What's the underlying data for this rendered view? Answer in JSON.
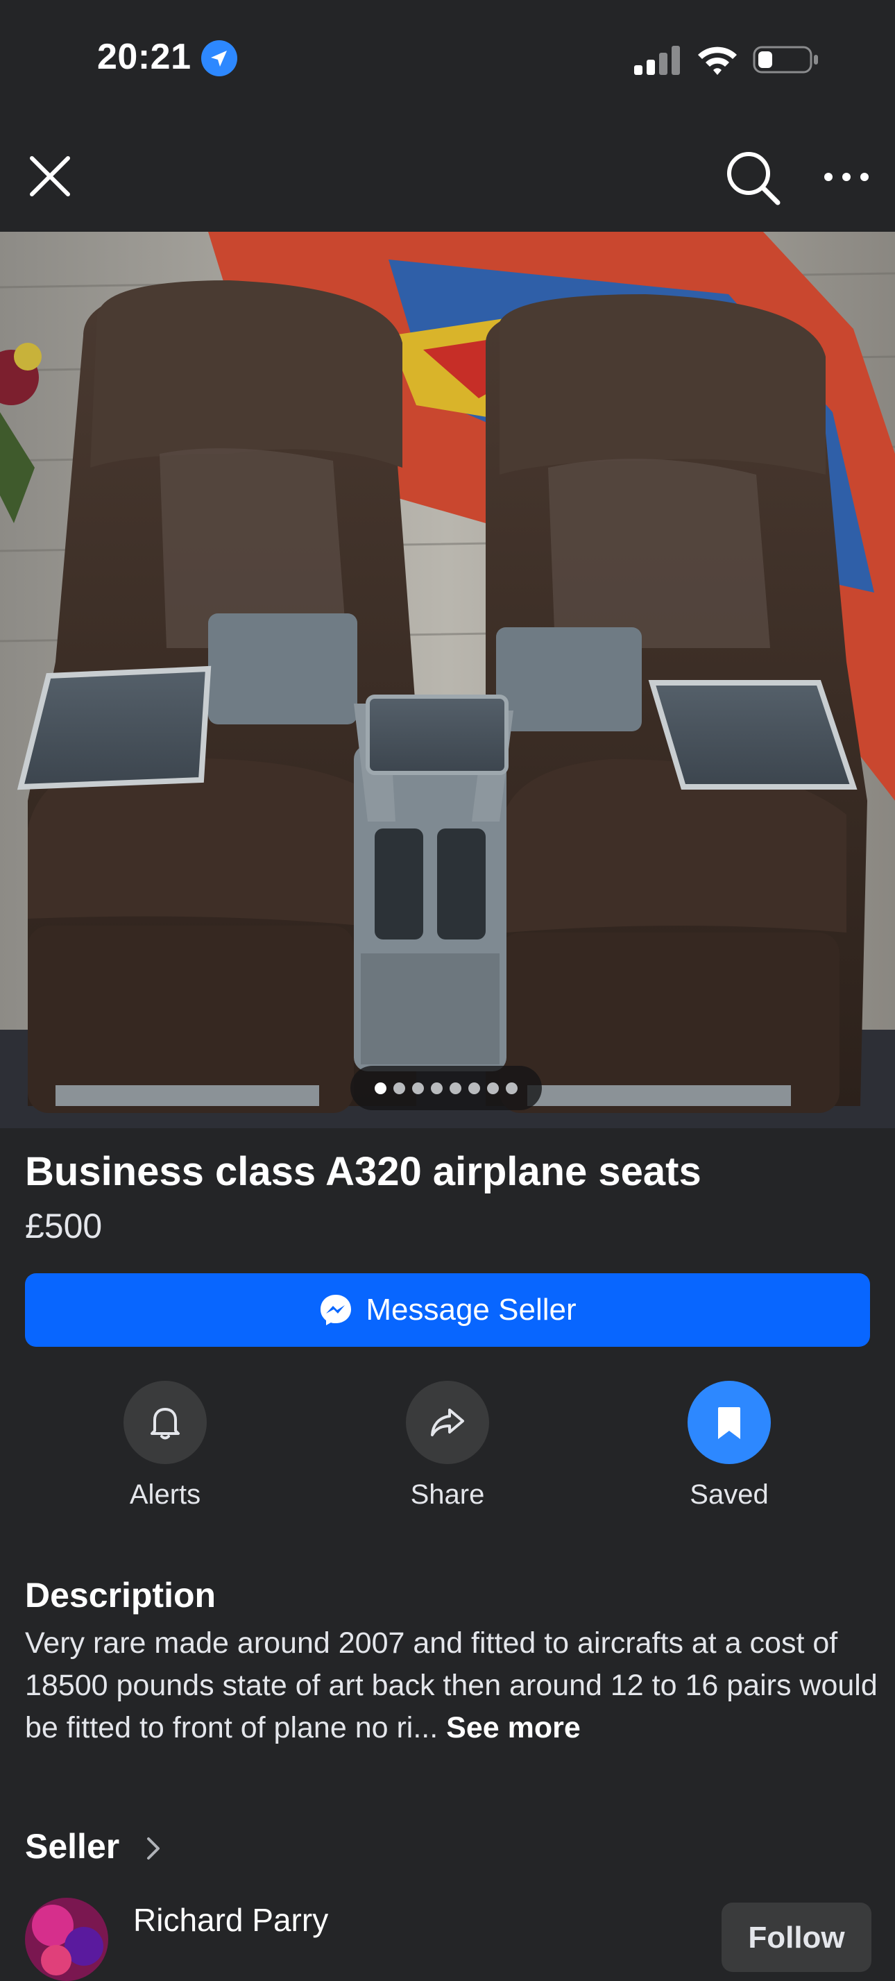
{
  "status_bar": {
    "time": "20:21",
    "icons": [
      "location-arrow-icon",
      "cellular-signal-icon",
      "wifi-icon",
      "battery-icon"
    ]
  },
  "nav": {
    "icons": [
      "close-icon",
      "search-icon",
      "more-icon"
    ]
  },
  "photo": {
    "page_count": 8,
    "current_page": 1
  },
  "listing": {
    "title": "Business  class  A320 airplane  seats",
    "price": "£500"
  },
  "message_button": {
    "label": "Message Seller",
    "icon": "messenger-icon"
  },
  "actions": [
    {
      "label": "Alerts",
      "icon": "bell-icon",
      "active": false
    },
    {
      "label": "Share",
      "icon": "share-icon",
      "active": false
    },
    {
      "label": "Saved",
      "icon": "bookmark-icon",
      "active": true
    }
  ],
  "description": {
    "heading": "Description",
    "text": "Very rare made around 2007 and fitted to aircrafts  at a cost of 18500 pounds  state of art back then  around  12 to 16 pairs would be fitted  to front  of plane  no ri...",
    "see_more": "See more"
  },
  "seller": {
    "heading": "Seller",
    "name": "Richard Parry",
    "follow_label": "Follow"
  },
  "colors": {
    "background": "#242527",
    "accent": "#0866ff",
    "saved_accent": "#2d88ff",
    "circle_bg": "#3a3b3c"
  }
}
